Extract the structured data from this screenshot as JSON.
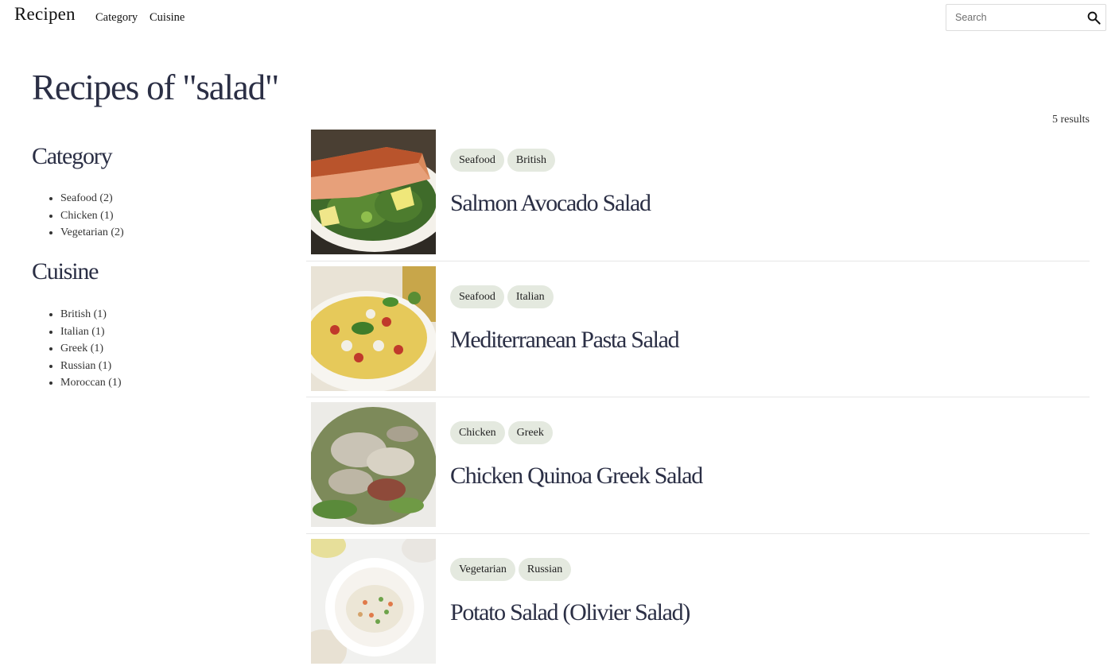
{
  "header": {
    "brand": "Recipen",
    "nav": [
      "Category",
      "Cuisine"
    ],
    "search": {
      "placeholder": "Search",
      "value": ""
    }
  },
  "page": {
    "title": "Recipes of \"salad\"",
    "results_count": "5 results"
  },
  "sidebar": {
    "category_heading": "Category",
    "categories": [
      "Seafood (2)",
      "Chicken (1)",
      "Vegetarian (2)"
    ],
    "cuisine_heading": "Cuisine",
    "cuisines": [
      "British (1)",
      "Italian (1)",
      "Greek (1)",
      "Russian (1)",
      "Moroccan (1)"
    ]
  },
  "results": [
    {
      "title": "Salmon Avocado Salad",
      "tags": [
        "Seafood",
        "British"
      ],
      "image": "salmon-salad-photo"
    },
    {
      "title": "Mediterranean Pasta Salad",
      "tags": [
        "Seafood",
        "Italian"
      ],
      "image": "pasta-salad-photo"
    },
    {
      "title": "Chicken Quinoa Greek Salad",
      "tags": [
        "Chicken",
        "Greek"
      ],
      "image": "chicken-salad-photo"
    },
    {
      "title": "Potato Salad (Olivier Salad)",
      "tags": [
        "Vegetarian",
        "Russian"
      ],
      "image": "olivier-salad-photo"
    }
  ],
  "colors": {
    "heading": "#2b2f45",
    "tag_bg": "#e4e9df",
    "divider": "#e6e6e6"
  }
}
